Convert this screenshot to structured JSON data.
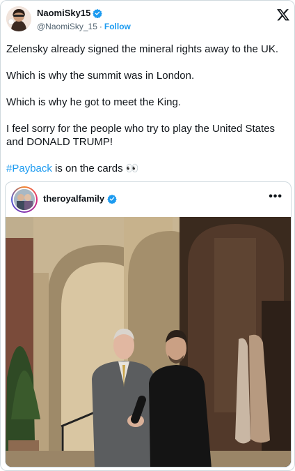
{
  "author": {
    "name": "NaomiSky15",
    "handle": "@NaomiSky_15",
    "separator": "·",
    "follow_label": "Follow"
  },
  "tweet": {
    "lines": [
      "Zelensky already signed the mineral rights away to the UK.",
      "Which is why the summit was in London.",
      "Which is why he got to meet the King.",
      "I feel sorry for the people who try to play the United States and DONALD TRUMP!"
    ],
    "hashtag": "#Payback",
    "last_line_rest": " is on the cards 👀"
  },
  "quote": {
    "account_name": "theroyalfamily",
    "more_label": "•••"
  },
  "colors": {
    "accent": "#1d9bf0",
    "text": "#0f1419",
    "muted": "#536471",
    "border": "#cfd9de"
  },
  "icons": {
    "brand": "x-logo-icon",
    "verified": "verified-badge-icon",
    "more": "more-options-icon"
  }
}
